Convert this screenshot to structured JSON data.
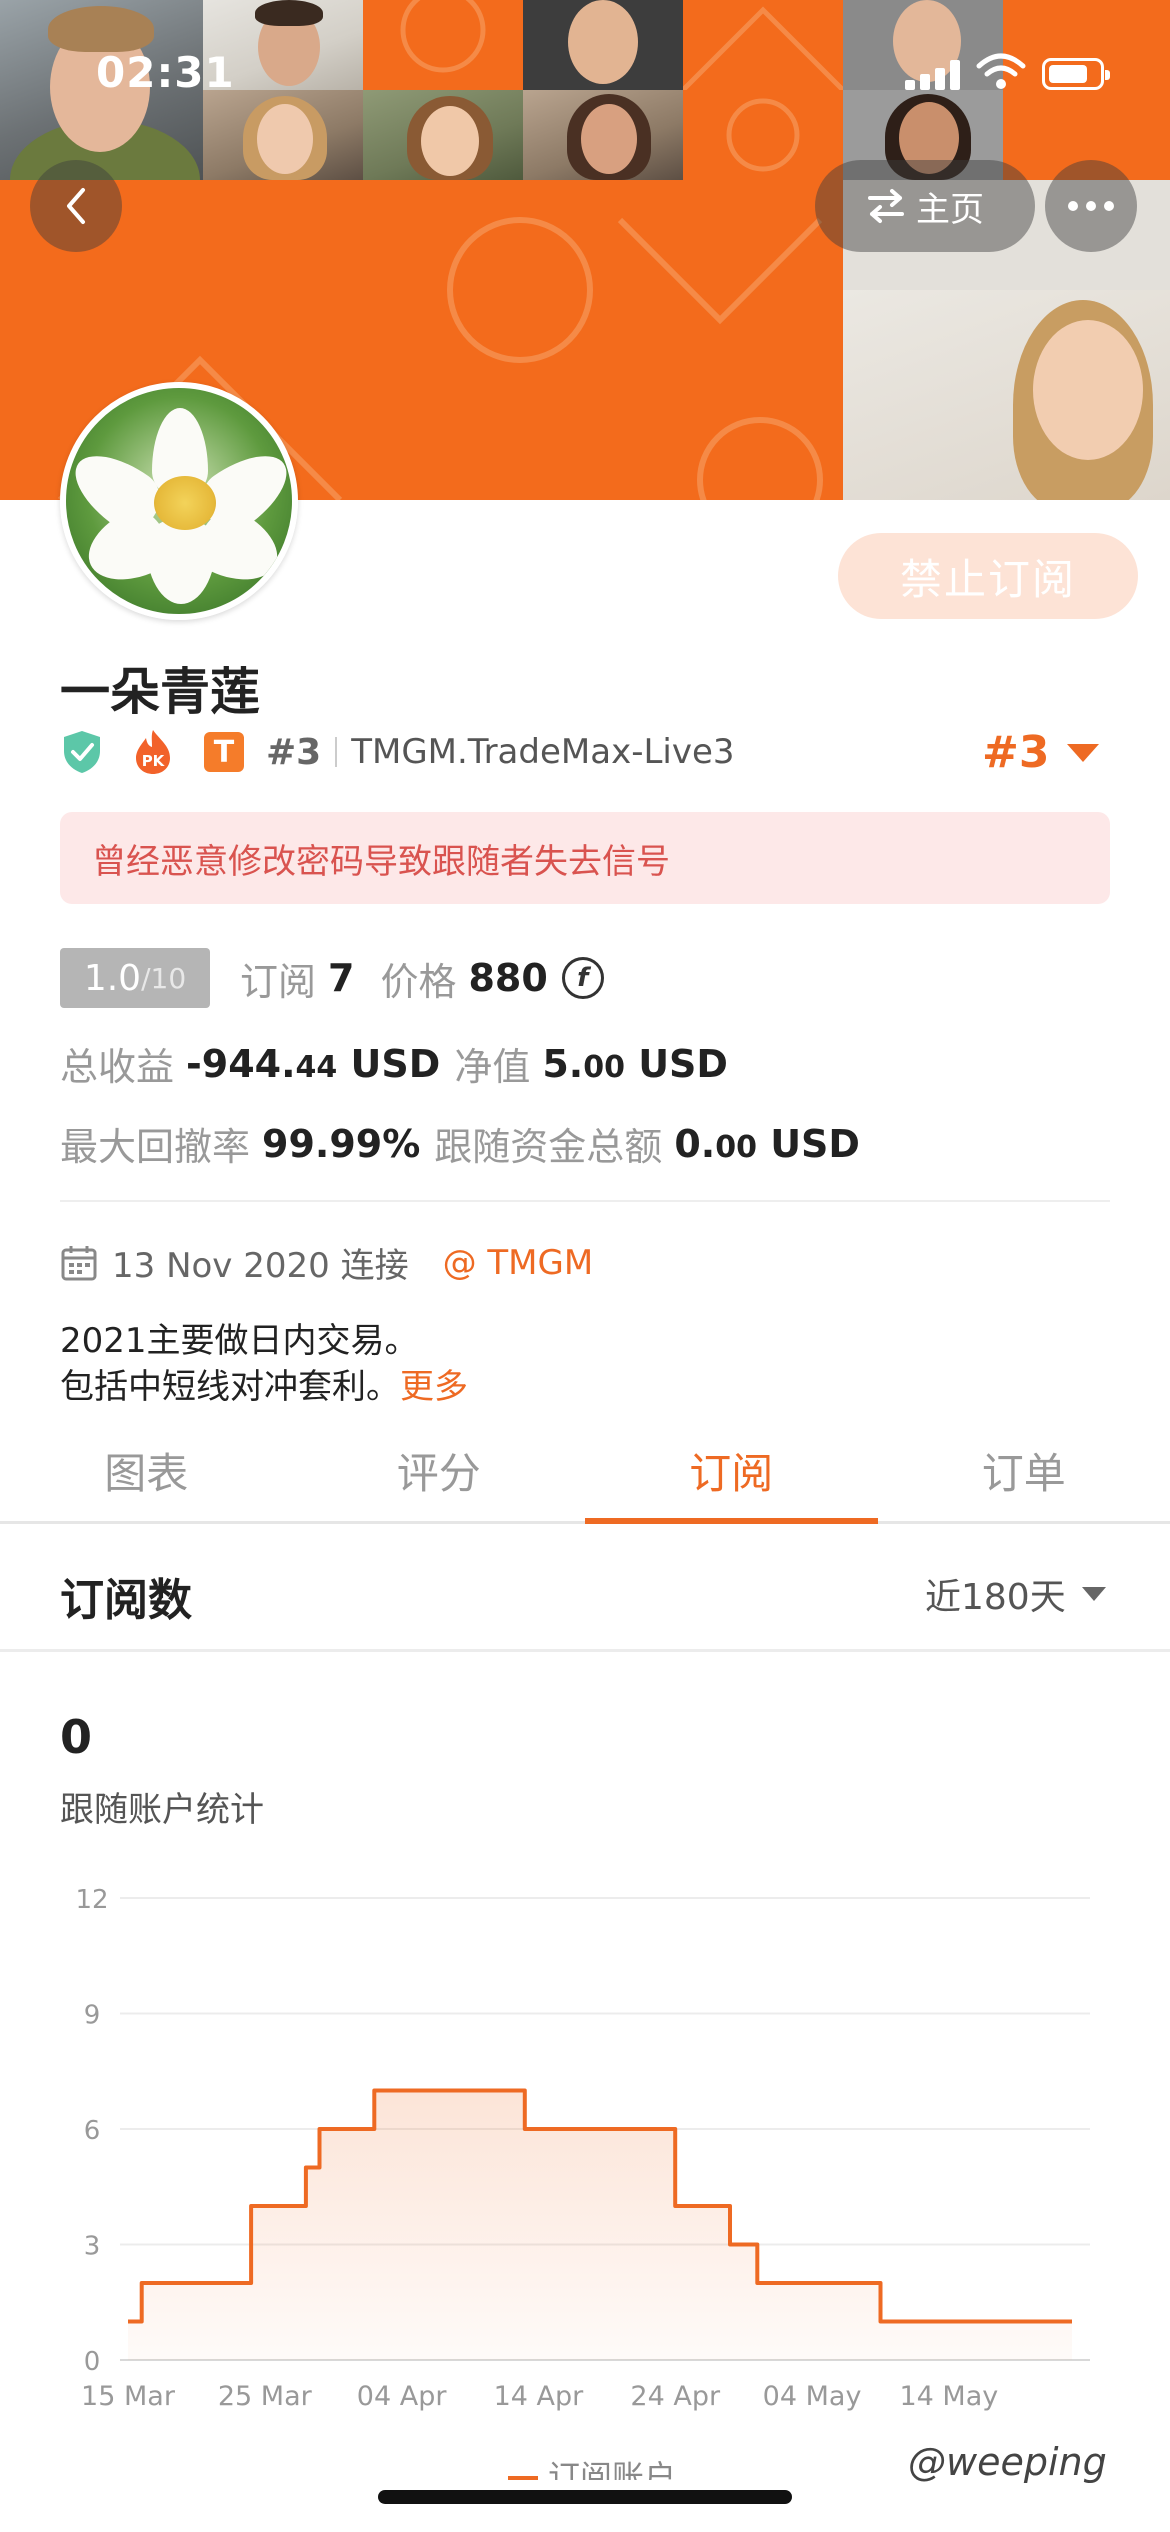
{
  "status_bar": {
    "time": "02:31"
  },
  "nav": {
    "home_label": "主页",
    "back_icon": "chevron-left-icon",
    "swap_icon": "swap-arrows-icon",
    "more_icon": "ellipsis-icon"
  },
  "profile": {
    "name": "一朵青莲",
    "subscribe_button": "禁止订阅",
    "rank_small": "#3",
    "server": "TMGM.TradeMax-Live3",
    "rank_big": "#3",
    "badges": [
      "shield-check-icon",
      "pk-flame-icon",
      "t-badge-icon"
    ],
    "t_badge": "T",
    "pk_badge": "PK",
    "warning": "曾经恶意修改密码导致跟随者失去信号"
  },
  "stats": {
    "score": "1.0",
    "score_max": "/10",
    "subscriptions_label": "订阅",
    "subscriptions_value": "7",
    "price_label": "价格",
    "price_value": "880",
    "coin_symbol": "f",
    "total_profit_label": "总收益",
    "total_profit_main": "-944.",
    "total_profit_dec": "44",
    "total_profit_unit": "USD",
    "equity_label": "净值",
    "equity_main": "5.",
    "equity_dec": "00",
    "equity_unit": "USD",
    "drawdown_label": "最大回撤率",
    "drawdown_value": "99.99%",
    "follow_funds_label": "跟随资金总额",
    "follow_funds_main": "0.",
    "follow_funds_dec": "00",
    "follow_funds_unit": "USD"
  },
  "join": {
    "date_text": "13 Nov 2020 连接",
    "broker": "@ TMGM"
  },
  "bio": {
    "line1": "2021主要做日内交易。",
    "line2": "包括中短线对冲套利。",
    "more": "更多"
  },
  "tabs": [
    {
      "label": "图表",
      "active": false
    },
    {
      "label": "评分",
      "active": false
    },
    {
      "label": "订阅",
      "active": true
    },
    {
      "label": "订单",
      "active": false
    }
  ],
  "section": {
    "title": "订阅数",
    "range": "近180天",
    "count": "0",
    "subtitle": "跟随账户统计"
  },
  "chart_data": {
    "type": "area",
    "y_ticks": [
      0,
      3,
      6,
      9,
      12
    ],
    "ylim": [
      0,
      12
    ],
    "x_ticks": [
      "15 Mar",
      "25 Mar",
      "04 Apr",
      "14 Apr",
      "24 Apr",
      "04 May",
      "14 May"
    ],
    "xlim": [
      "2021-03-15",
      "2021-05-23"
    ],
    "series": [
      {
        "name": "订阅账户",
        "color": "#ee6a23",
        "x": [
          "2021-03-15",
          "2021-03-16",
          "2021-03-23",
          "2021-03-24",
          "2021-03-27",
          "2021-03-28",
          "2021-03-29",
          "2021-04-02",
          "2021-04-13",
          "2021-04-24",
          "2021-04-28",
          "2021-04-30",
          "2021-05-09",
          "2021-05-23"
        ],
        "values": [
          1,
          2,
          2,
          4,
          4,
          5,
          6,
          7,
          6,
          4,
          3,
          2,
          1,
          1
        ]
      }
    ],
    "grid": true,
    "legend": "bottom"
  },
  "watermark": "@weeping"
}
